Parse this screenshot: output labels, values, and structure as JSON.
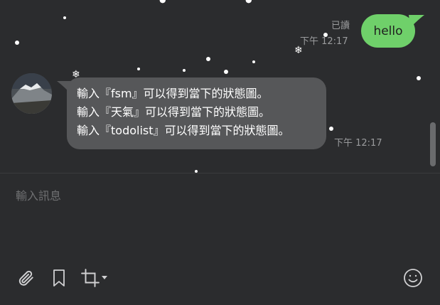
{
  "chat": {
    "outgoing": {
      "read_label": "已讀",
      "time": "下午 12:17",
      "text": "hello"
    },
    "incoming": {
      "lines": [
        "輸入『fsm』可以得到當下的狀態圖。",
        "輸入『天氣』可以得到當下的狀態圖。",
        "輸入『todolist』可以得到當下的狀態圖。"
      ],
      "time": "下午 12:17"
    }
  },
  "composer": {
    "placeholder": "輸入訊息"
  },
  "icons": {
    "attach": "paperclip-icon",
    "bookmark": "bookmark-icon",
    "crop": "crop-icon",
    "dropdown": "caret-down-icon",
    "emoji": "smiley-icon"
  },
  "colors": {
    "outgoing_bubble": "#6fd06a",
    "incoming_bubble": "#565759",
    "background": "#2b2c2e"
  }
}
